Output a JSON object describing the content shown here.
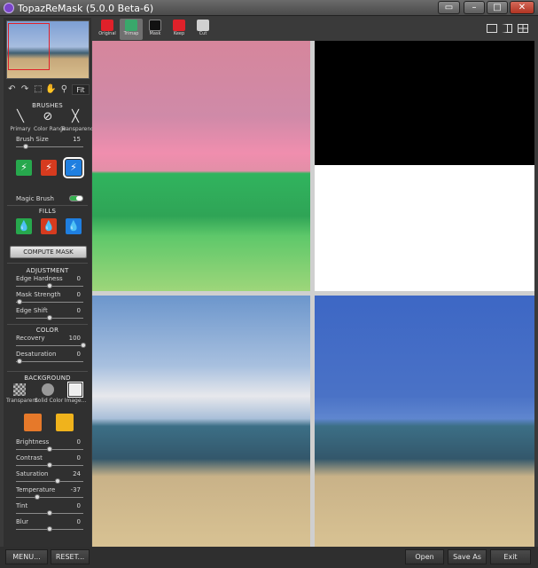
{
  "window": {
    "title": "TopazReMask (5.0.0 Beta-6)"
  },
  "left_panel": {
    "tools": {
      "fit_label": "Fit"
    },
    "brushes": {
      "heading": "BRUSHES",
      "types": [
        {
          "label": "Primary",
          "icon": "brush-icon"
        },
        {
          "label": "Color Range",
          "icon": "color-range-brush-icon"
        },
        {
          "label": "Transparency",
          "icon": "transparency-brush-icon"
        }
      ],
      "brush_size_label": "Brush Size",
      "brush_size_value": "15",
      "brush_size_level": 0.15,
      "colors": [
        "#27a84d",
        "#d63b1f",
        "#1f7fe0"
      ],
      "magic_brush_label": "Magic Brush",
      "magic_brush_on": true
    },
    "fills": {
      "heading": "FILLS"
    },
    "compute_mask_label": "COMPUTE MASK",
    "adjustment": {
      "heading": "ADJUSTMENT",
      "items": [
        {
          "label": "Edge Hardness",
          "value": "0",
          "level": 0.5
        },
        {
          "label": "Mask Strength",
          "value": "0",
          "level": 0.05
        },
        {
          "label": "Edge Shift",
          "value": "0",
          "level": 0.5
        }
      ]
    },
    "color": {
      "heading": "COLOR",
      "items": [
        {
          "label": "Recovery",
          "value": "100",
          "level": 1.0
        },
        {
          "label": "Desaturation",
          "value": "0",
          "level": 0.05
        }
      ]
    },
    "background": {
      "heading": "BACKGROUND",
      "types": [
        {
          "label": "Transparent",
          "icon": "checkerboard-icon"
        },
        {
          "label": "Solid Color",
          "icon": "palette-icon"
        },
        {
          "label": "Image...",
          "icon": "image-icon"
        }
      ],
      "items": [
        {
          "label": "Brightness",
          "value": "0",
          "level": 0.5
        },
        {
          "label": "Contrast",
          "value": "0",
          "level": 0.5
        },
        {
          "label": "Saturation",
          "value": "24",
          "level": 0.62
        },
        {
          "label": "Temperature",
          "value": "-37",
          "level": 0.31
        },
        {
          "label": "Tint",
          "value": "0",
          "level": 0.5
        },
        {
          "label": "Blur",
          "value": "0",
          "level": 0.5
        }
      ]
    }
  },
  "modes": [
    {
      "label": "Original",
      "color": "#e0212a"
    },
    {
      "label": "Trimap",
      "color": "#39a86b"
    },
    {
      "label": "Mask",
      "color": "#111111"
    },
    {
      "label": "Keep",
      "color": "#e0212a"
    },
    {
      "label": "Cut",
      "color": "#d0d0d0"
    }
  ],
  "bottom": {
    "menu_label": "MENU...",
    "reset_label": "RESET...",
    "open_label": "Open",
    "save_as_label": "Save As",
    "exit_label": "Exit"
  }
}
